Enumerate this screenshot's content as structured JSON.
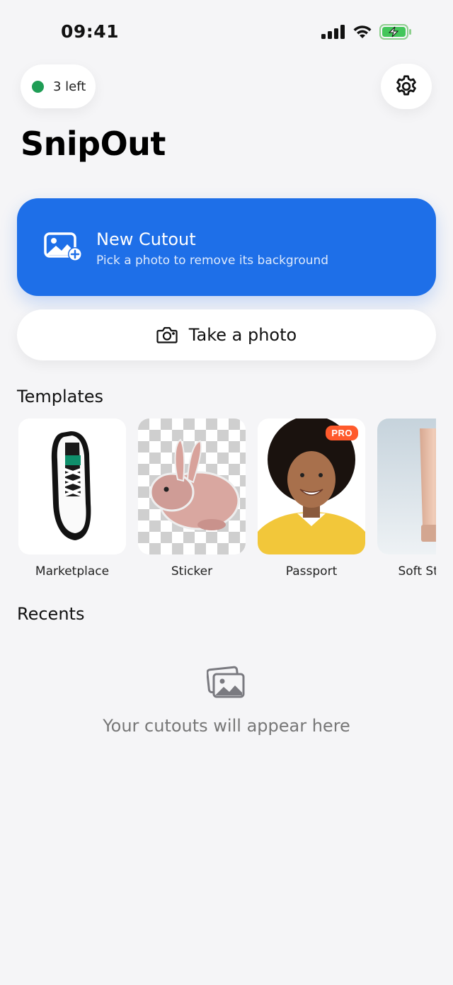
{
  "status_bar": {
    "time": "09:41",
    "icons": [
      "cellular-signal-icon",
      "wifi-icon",
      "battery-charging-icon"
    ]
  },
  "credits": {
    "label": "3 left",
    "dot_color": "#1f9d55"
  },
  "settings": {
    "icon": "gear-icon"
  },
  "app": {
    "title": "SnipOut"
  },
  "new_cutout": {
    "title": "New Cutout",
    "subtitle": "Pick a photo to remove its background",
    "icon": "add-photo-icon",
    "color": "#1e6fe8"
  },
  "take_photo": {
    "label": "Take a photo",
    "icon": "camera-icon"
  },
  "templates": {
    "title": "Templates",
    "items": [
      {
        "label": "Marketplace",
        "image": "sneaker-on-white"
      },
      {
        "label": "Sticker",
        "image": "rabbit-on-transparent"
      },
      {
        "label": "Passport",
        "image": "portrait-yellow-sweater",
        "badge": "PRO"
      },
      {
        "label": "Soft Studio",
        "image": "cosmetic-tube"
      }
    ]
  },
  "recents": {
    "title": "Recents",
    "empty_text": "Your cutouts will appear here",
    "empty_icon": "photo-stack-icon"
  }
}
